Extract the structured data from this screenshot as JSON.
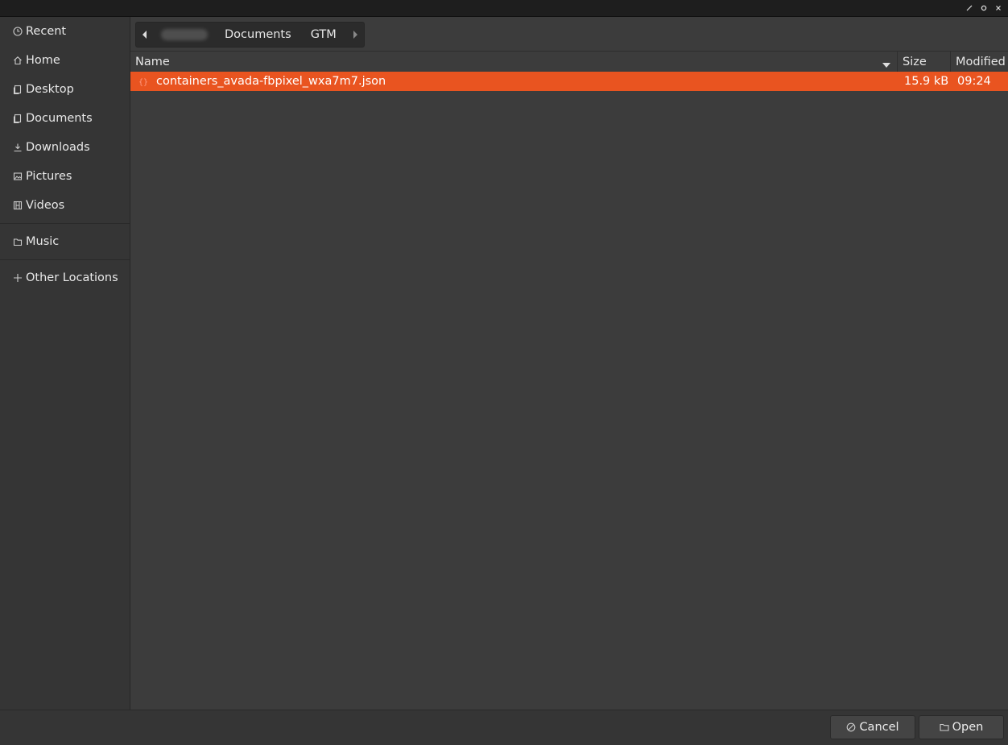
{
  "window": {
    "controls": [
      {
        "name": "minimize-icon"
      },
      {
        "name": "maximize-icon"
      },
      {
        "name": "close-icon"
      }
    ]
  },
  "sidebar": {
    "items": [
      {
        "label": "Recent",
        "icon": "clock-icon"
      },
      {
        "label": "Home",
        "icon": "home-icon"
      },
      {
        "label": "Desktop",
        "icon": "folder-icon"
      },
      {
        "label": "Documents",
        "icon": "folder-icon"
      },
      {
        "label": "Downloads",
        "icon": "download-icon"
      },
      {
        "label": "Pictures",
        "icon": "image-icon"
      },
      {
        "label": "Videos",
        "icon": "film-icon"
      },
      {
        "label": "Music",
        "icon": "folder-icon"
      },
      {
        "label": "Other Locations",
        "icon": "plus-icon"
      }
    ]
  },
  "pathbar": {
    "segments": [
      "Documents",
      "GTM"
    ],
    "home_redacted": true
  },
  "filelist": {
    "columns": {
      "name": "Name",
      "size": "Size",
      "modified": "Modified"
    },
    "rows": [
      {
        "name": "containers_avada-fbpixel_wxa7m7.json",
        "size": "15.9 kB",
        "modified": "09:24",
        "icon": "json-file-icon",
        "selected": true
      }
    ]
  },
  "actions": {
    "cancel": "Cancel",
    "open": "Open"
  },
  "colors": {
    "accent": "#e95420",
    "background": "#3c3c3c",
    "sidebar": "#353535",
    "titlebar": "#1e1e1e"
  }
}
